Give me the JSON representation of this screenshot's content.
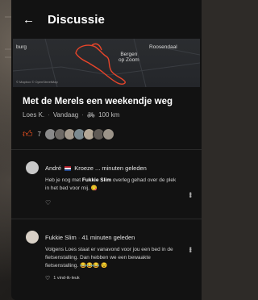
{
  "header": {
    "back_icon": "arrow-left-icon",
    "title": "Discussie"
  },
  "map": {
    "labels": {
      "roosendaal": "Roosendaal",
      "bergen": "Bergen\nop Zoom",
      "left": "burg"
    },
    "copyright": "© Mapbox © OpenStreetMap"
  },
  "ride": {
    "title": "Met de Merels een weekendje weg",
    "author": "Loes K.",
    "date": "Vandaag",
    "distance": "100 km"
  },
  "likes": {
    "count": "7"
  },
  "comments": [
    {
      "author": "André",
      "header_rest": "Kroeze ... minuten geleden",
      "body_pre": "Heb je nog met ",
      "body_bold": "Fukkie Slim",
      "body_post": " overleg gehad over de plek in het bed voor mij. 😋"
    },
    {
      "author": "Fukkie Slim",
      "header_rest": "41 minuten geleden",
      "body": "Volgens Loes staat er vanavond voor jou een bed in de fietsenstalling. Dan hebben we een bewaakte fietsenstalling. 😂😂😂 😉",
      "likes_label": "1 vind-ik-leuk"
    }
  ],
  "colors": {
    "accent": "#ff5722",
    "route": "#e8452a",
    "background": "#121212"
  }
}
